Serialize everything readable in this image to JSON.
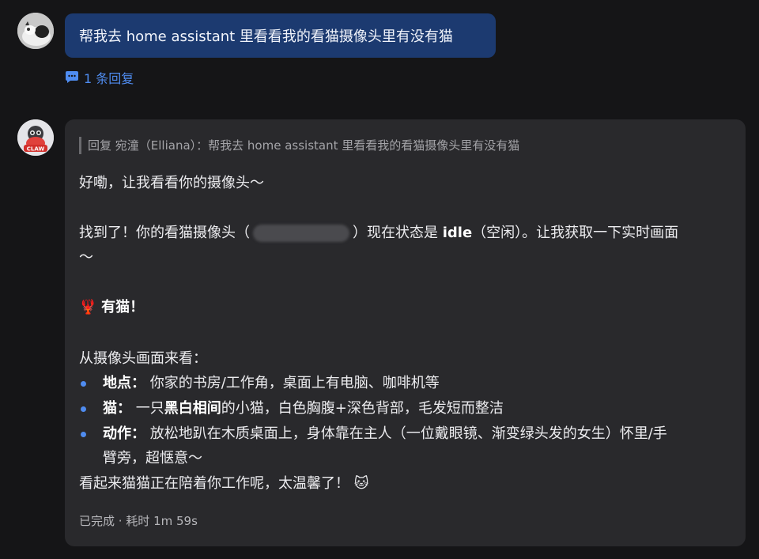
{
  "user_message": {
    "text": "帮我去 home assistant 里看看我的看猫摄像头里有没有猫",
    "reply_count": "1 条回复"
  },
  "bot_message": {
    "avatar_label": "CLAW",
    "quote": "回复 宛潼（Elliana）：帮我去 home assistant 里看看我的看猫摄像头里有没有猫",
    "line1": "好嘞，让我看看你的摄像头～",
    "line2_a": "找到了！你的看猫摄像头（",
    "line2_b": "）现在状态是 ",
    "line2_bold": "idle",
    "line2_c": "（空闲）。让我获取一下实时画面",
    "line2_wrap": "～",
    "heading_emoji": "🦞",
    "heading": "有猫！",
    "section_intro": "从摄像头画面来看：",
    "items": [
      {
        "label": "地点：",
        "text": "你家的书房/工作角，桌面上有电脑、咖啡机等"
      },
      {
        "label": "猫：",
        "text_a": "一只",
        "bold": "黑白相间",
        "text_b": "的小猫，白色胸腹+深色背部，毛发短而整洁"
      },
      {
        "label": "动作：",
        "text": "放松地趴在木质桌面上，身体靠在主人（一位戴眼镜、渐变绿头发的女生）怀里/手",
        "wrap": "臂旁，超惬意～"
      }
    ],
    "closing": "看起来猫猫正在陪着你工作呢，太温馨了！",
    "closing_emoji": "🐱",
    "status": "已完成 · 耗时 1m 59s"
  },
  "colors": {
    "background": "#151517",
    "user_bubble": "#1c3a70",
    "bot_card": "#29292c",
    "accent": "#4f8cf0"
  }
}
